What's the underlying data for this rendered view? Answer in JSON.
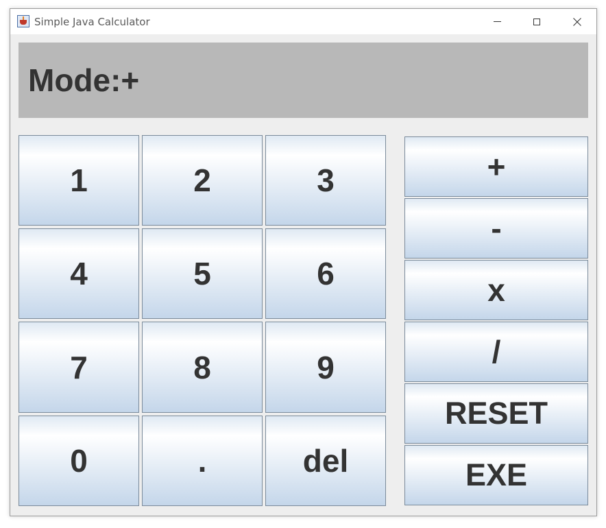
{
  "window": {
    "title": "Simple Java Calculator"
  },
  "display": {
    "text": "Mode:+"
  },
  "keypad": {
    "rows": [
      [
        "1",
        "2",
        "3"
      ],
      [
        "4",
        "5",
        "6"
      ],
      [
        "7",
        "8",
        "9"
      ],
      [
        "0",
        ".",
        "del"
      ]
    ]
  },
  "operators": [
    "+",
    "-",
    "x",
    "/",
    "RESET",
    "EXE"
  ]
}
